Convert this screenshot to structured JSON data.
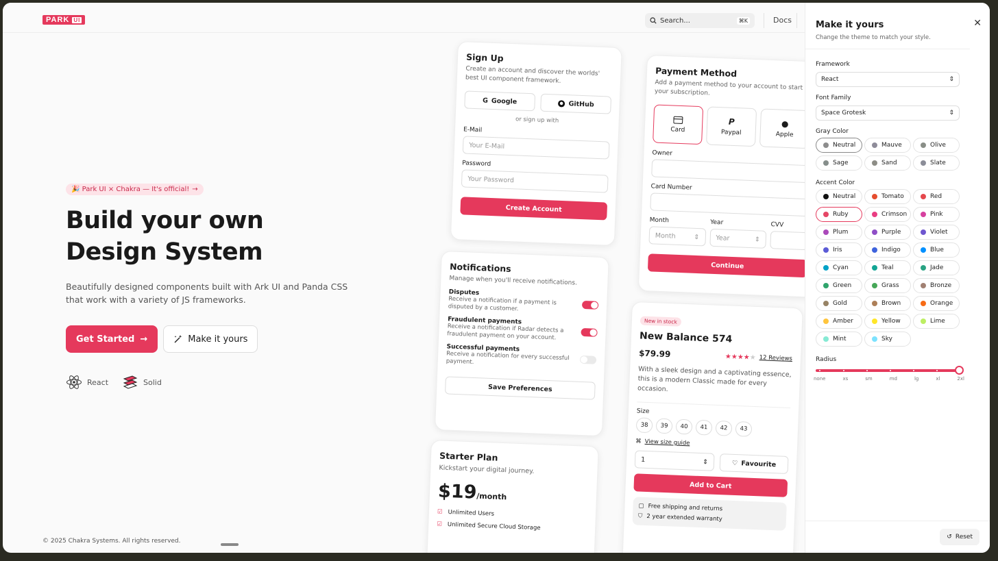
{
  "header": {
    "logo": "PARK",
    "logo_badge": "UI",
    "search_placeholder": "Search...",
    "search_shortcut": "⌘K",
    "docs": "Docs"
  },
  "hero": {
    "pill": "🎉 Park UI × Chakra — It's official!",
    "title_line1": "Build your own",
    "title_line2": "Design System",
    "description": "Beautifully designed components built with Ark UI and Panda CSS that work with a variety of JS frameworks.",
    "get_started": "Get Started",
    "make_it_yours": "Make it yours",
    "frameworks": [
      "React",
      "Solid"
    ]
  },
  "footer": "© 2025 Chakra Systems. All rights reserved.",
  "signup": {
    "title": "Sign Up",
    "subtitle": "Create an account and discover the worlds' best UI component framework.",
    "google": "Google",
    "github": "GitHub",
    "divider": "or sign up with",
    "email_label": "E-Mail",
    "email_placeholder": "Your E-Mail",
    "password_label": "Password",
    "password_placeholder": "Your Password",
    "submit": "Create Account"
  },
  "payment": {
    "title": "Payment Method",
    "subtitle": "Add a payment method to your account to start your subscription.",
    "methods": [
      "Card",
      "Paypal",
      "Apple"
    ],
    "owner_label": "Owner",
    "card_number_label": "Card Number",
    "month_label": "Month",
    "month_placeholder": "Month",
    "year_label": "Year",
    "year_placeholder": "Year",
    "cvv_label": "CVV",
    "continue": "Continue"
  },
  "notifications": {
    "title": "Notifications",
    "subtitle": "Manage when you'll receive notifications.",
    "items": [
      {
        "title": "Disputes",
        "desc": "Receive a notification if a payment is disputed by a customer.",
        "on": true
      },
      {
        "title": "Fraudulent payments",
        "desc": "Receive a notification if Radar detects a fraudulent payment on your account.",
        "on": true
      },
      {
        "title": "Successful payments",
        "desc": "Receive a notification for every successful payment.",
        "on": false
      }
    ],
    "save": "Save Preferences"
  },
  "product": {
    "badge": "New in stock",
    "name": "New Balance 574",
    "price": "$79.99",
    "rating": 4,
    "reviews": "12 Reviews",
    "description": "With a sleek design and a captivating essence, this is a modern Classic made for every occasion.",
    "size_label": "Size",
    "sizes": [
      "38",
      "39",
      "40",
      "41",
      "42",
      "43"
    ],
    "size_guide": "View size guide",
    "quantity": "1",
    "favourite": "Favourite",
    "add_to_cart": "Add to Cart",
    "perks": [
      "Free shipping and returns",
      "2 year extended warranty"
    ]
  },
  "plan": {
    "title": "Starter Plan",
    "subtitle": "Kickstart your digital journey.",
    "price": "$19",
    "period": "/month",
    "features": [
      "Unlimited Users",
      "Unlimited Secure Cloud Storage"
    ]
  },
  "panel": {
    "title": "Make it yours",
    "subtitle": "Change the theme to match your style.",
    "framework_label": "Framework",
    "framework": "React",
    "font_label": "Font Family",
    "font": "Space Grotesk",
    "gray_label": "Gray Color",
    "grays": [
      {
        "name": "Neutral",
        "color": "#8d8d8d"
      },
      {
        "name": "Mauve",
        "color": "#8e8c99"
      },
      {
        "name": "Olive",
        "color": "#898e87"
      },
      {
        "name": "Sage",
        "color": "#868e8b"
      },
      {
        "name": "Sand",
        "color": "#8d8d86"
      },
      {
        "name": "Slate",
        "color": "#8b8d98"
      }
    ],
    "accent_label": "Accent Color",
    "accents": [
      {
        "name": "Neutral",
        "color": "#111111"
      },
      {
        "name": "Tomato",
        "color": "#e54d2e"
      },
      {
        "name": "Red",
        "color": "#e5484d"
      },
      {
        "name": "Ruby",
        "color": "#e54666"
      },
      {
        "name": "Crimson",
        "color": "#e93d82"
      },
      {
        "name": "Pink",
        "color": "#d6409f"
      },
      {
        "name": "Plum",
        "color": "#ab4aba"
      },
      {
        "name": "Purple",
        "color": "#8e4ec6"
      },
      {
        "name": "Violet",
        "color": "#6e56cf"
      },
      {
        "name": "Iris",
        "color": "#5b5bd6"
      },
      {
        "name": "Indigo",
        "color": "#3e63dd"
      },
      {
        "name": "Blue",
        "color": "#0090ff"
      },
      {
        "name": "Cyan",
        "color": "#00a2c7"
      },
      {
        "name": "Teal",
        "color": "#12a594"
      },
      {
        "name": "Jade",
        "color": "#29a383"
      },
      {
        "name": "Green",
        "color": "#30a46c"
      },
      {
        "name": "Grass",
        "color": "#46a758"
      },
      {
        "name": "Bronze",
        "color": "#a18072"
      },
      {
        "name": "Gold",
        "color": "#978365"
      },
      {
        "name": "Brown",
        "color": "#ad7f58"
      },
      {
        "name": "Orange",
        "color": "#f76b15"
      },
      {
        "name": "Amber",
        "color": "#ffc53d"
      },
      {
        "name": "Yellow",
        "color": "#ffe629"
      },
      {
        "name": "Lime",
        "color": "#bdee63"
      },
      {
        "name": "Mint",
        "color": "#86ead4"
      },
      {
        "name": "Sky",
        "color": "#7ce2fe"
      }
    ],
    "radius_label": "Radius",
    "radius_ticks": [
      "none",
      "xs",
      "sm",
      "md",
      "lg",
      "xl",
      "2xl"
    ],
    "radius_selected": "2xl",
    "reset": "Reset"
  },
  "colors": {
    "accent": "#e5395c"
  }
}
